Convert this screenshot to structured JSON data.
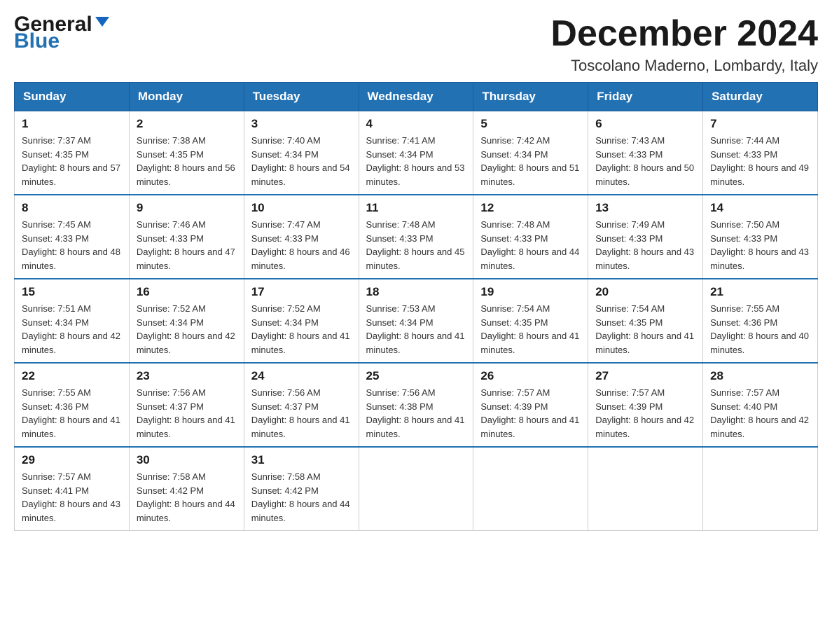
{
  "header": {
    "logo_line1": "General",
    "logo_line2": "Blue",
    "month_title": "December 2024",
    "subtitle": "Toscolano Maderno, Lombardy, Italy"
  },
  "days_of_week": [
    "Sunday",
    "Monday",
    "Tuesday",
    "Wednesday",
    "Thursday",
    "Friday",
    "Saturday"
  ],
  "weeks": [
    [
      {
        "day": "1",
        "sunrise": "7:37 AM",
        "sunset": "4:35 PM",
        "daylight": "8 hours and 57 minutes."
      },
      {
        "day": "2",
        "sunrise": "7:38 AM",
        "sunset": "4:35 PM",
        "daylight": "8 hours and 56 minutes."
      },
      {
        "day": "3",
        "sunrise": "7:40 AM",
        "sunset": "4:34 PM",
        "daylight": "8 hours and 54 minutes."
      },
      {
        "day": "4",
        "sunrise": "7:41 AM",
        "sunset": "4:34 PM",
        "daylight": "8 hours and 53 minutes."
      },
      {
        "day": "5",
        "sunrise": "7:42 AM",
        "sunset": "4:34 PM",
        "daylight": "8 hours and 51 minutes."
      },
      {
        "day": "6",
        "sunrise": "7:43 AM",
        "sunset": "4:33 PM",
        "daylight": "8 hours and 50 minutes."
      },
      {
        "day": "7",
        "sunrise": "7:44 AM",
        "sunset": "4:33 PM",
        "daylight": "8 hours and 49 minutes."
      }
    ],
    [
      {
        "day": "8",
        "sunrise": "7:45 AM",
        "sunset": "4:33 PM",
        "daylight": "8 hours and 48 minutes."
      },
      {
        "day": "9",
        "sunrise": "7:46 AM",
        "sunset": "4:33 PM",
        "daylight": "8 hours and 47 minutes."
      },
      {
        "day": "10",
        "sunrise": "7:47 AM",
        "sunset": "4:33 PM",
        "daylight": "8 hours and 46 minutes."
      },
      {
        "day": "11",
        "sunrise": "7:48 AM",
        "sunset": "4:33 PM",
        "daylight": "8 hours and 45 minutes."
      },
      {
        "day": "12",
        "sunrise": "7:48 AM",
        "sunset": "4:33 PM",
        "daylight": "8 hours and 44 minutes."
      },
      {
        "day": "13",
        "sunrise": "7:49 AM",
        "sunset": "4:33 PM",
        "daylight": "8 hours and 43 minutes."
      },
      {
        "day": "14",
        "sunrise": "7:50 AM",
        "sunset": "4:33 PM",
        "daylight": "8 hours and 43 minutes."
      }
    ],
    [
      {
        "day": "15",
        "sunrise": "7:51 AM",
        "sunset": "4:34 PM",
        "daylight": "8 hours and 42 minutes."
      },
      {
        "day": "16",
        "sunrise": "7:52 AM",
        "sunset": "4:34 PM",
        "daylight": "8 hours and 42 minutes."
      },
      {
        "day": "17",
        "sunrise": "7:52 AM",
        "sunset": "4:34 PM",
        "daylight": "8 hours and 41 minutes."
      },
      {
        "day": "18",
        "sunrise": "7:53 AM",
        "sunset": "4:34 PM",
        "daylight": "8 hours and 41 minutes."
      },
      {
        "day": "19",
        "sunrise": "7:54 AM",
        "sunset": "4:35 PM",
        "daylight": "8 hours and 41 minutes."
      },
      {
        "day": "20",
        "sunrise": "7:54 AM",
        "sunset": "4:35 PM",
        "daylight": "8 hours and 41 minutes."
      },
      {
        "day": "21",
        "sunrise": "7:55 AM",
        "sunset": "4:36 PM",
        "daylight": "8 hours and 40 minutes."
      }
    ],
    [
      {
        "day": "22",
        "sunrise": "7:55 AM",
        "sunset": "4:36 PM",
        "daylight": "8 hours and 41 minutes."
      },
      {
        "day": "23",
        "sunrise": "7:56 AM",
        "sunset": "4:37 PM",
        "daylight": "8 hours and 41 minutes."
      },
      {
        "day": "24",
        "sunrise": "7:56 AM",
        "sunset": "4:37 PM",
        "daylight": "8 hours and 41 minutes."
      },
      {
        "day": "25",
        "sunrise": "7:56 AM",
        "sunset": "4:38 PM",
        "daylight": "8 hours and 41 minutes."
      },
      {
        "day": "26",
        "sunrise": "7:57 AM",
        "sunset": "4:39 PM",
        "daylight": "8 hours and 41 minutes."
      },
      {
        "day": "27",
        "sunrise": "7:57 AM",
        "sunset": "4:39 PM",
        "daylight": "8 hours and 42 minutes."
      },
      {
        "day": "28",
        "sunrise": "7:57 AM",
        "sunset": "4:40 PM",
        "daylight": "8 hours and 42 minutes."
      }
    ],
    [
      {
        "day": "29",
        "sunrise": "7:57 AM",
        "sunset": "4:41 PM",
        "daylight": "8 hours and 43 minutes."
      },
      {
        "day": "30",
        "sunrise": "7:58 AM",
        "sunset": "4:42 PM",
        "daylight": "8 hours and 44 minutes."
      },
      {
        "day": "31",
        "sunrise": "7:58 AM",
        "sunset": "4:42 PM",
        "daylight": "8 hours and 44 minutes."
      },
      null,
      null,
      null,
      null
    ]
  ],
  "labels": {
    "sunrise": "Sunrise:",
    "sunset": "Sunset:",
    "daylight": "Daylight:"
  }
}
